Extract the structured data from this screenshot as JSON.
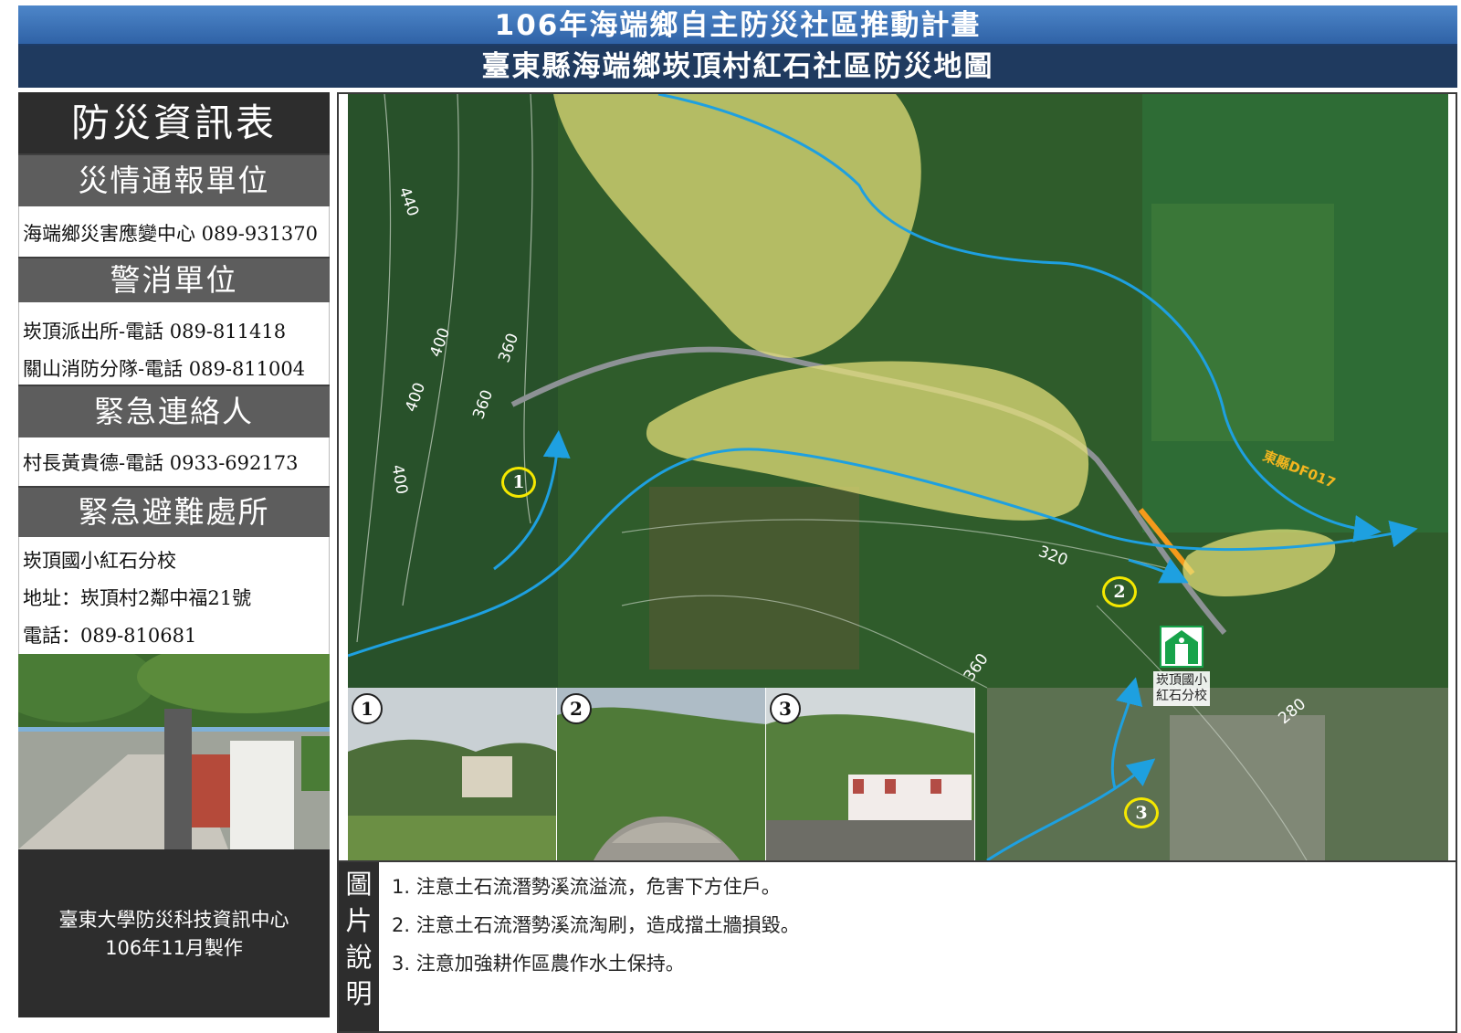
{
  "header": {
    "title": "106年海端鄉自主防災社區推動計畫",
    "subtitle": "臺東縣海端鄉崁頂村紅石社區防災地圖"
  },
  "info_panel": {
    "title": "防災資訊表",
    "sections": [
      {
        "heading": "災情通報單位",
        "lines": [
          "海端鄉災害應變中心 089-931370"
        ]
      },
      {
        "heading": "警消單位",
        "lines": [
          "崁頂派出所-電話 089-811418",
          "關山消防分隊-電話  089-811004"
        ]
      },
      {
        "heading": "緊急連絡人",
        "lines": [
          "村長黃貴德-電話  0933-692173"
        ]
      },
      {
        "heading": "緊急避難處所",
        "lines": [
          "崁頂國小紅石分校",
          "地址：崁頂村2鄰中福21號",
          "電話：089-810681"
        ]
      }
    ],
    "credit": [
      "臺東大學防災科技資訊中心",
      "106年11月製作"
    ]
  },
  "map": {
    "contour_labels": [
      "440",
      "400",
      "360",
      "400",
      "360",
      "400",
      "320",
      "360",
      "280"
    ],
    "creek_label": "東縣DF017",
    "markers": [
      "1",
      "2",
      "3"
    ],
    "shelter": {
      "icon": "emergency-exit-icon",
      "label_lines": [
        "崁頂國小",
        "紅石分校"
      ]
    },
    "photo_numbers": [
      "1",
      "2",
      "3"
    ],
    "colors": {
      "hazard_zone": "#e8e27a",
      "flow_path": "#1ea0e0",
      "marker": "#f5e800",
      "shelter_green": "#17a34a",
      "road_segment": "#f59a1b"
    }
  },
  "captions": {
    "label_chars": [
      "圖",
      "片",
      "說",
      "明"
    ],
    "lines": [
      "1. 注意土石流潛勢溪流溢流，危害下方住戶。",
      "2. 注意土石流潛勢溪流淘刷，造成擋土牆損毀。",
      "3. 注意加強耕作區農作水土保持。"
    ]
  }
}
